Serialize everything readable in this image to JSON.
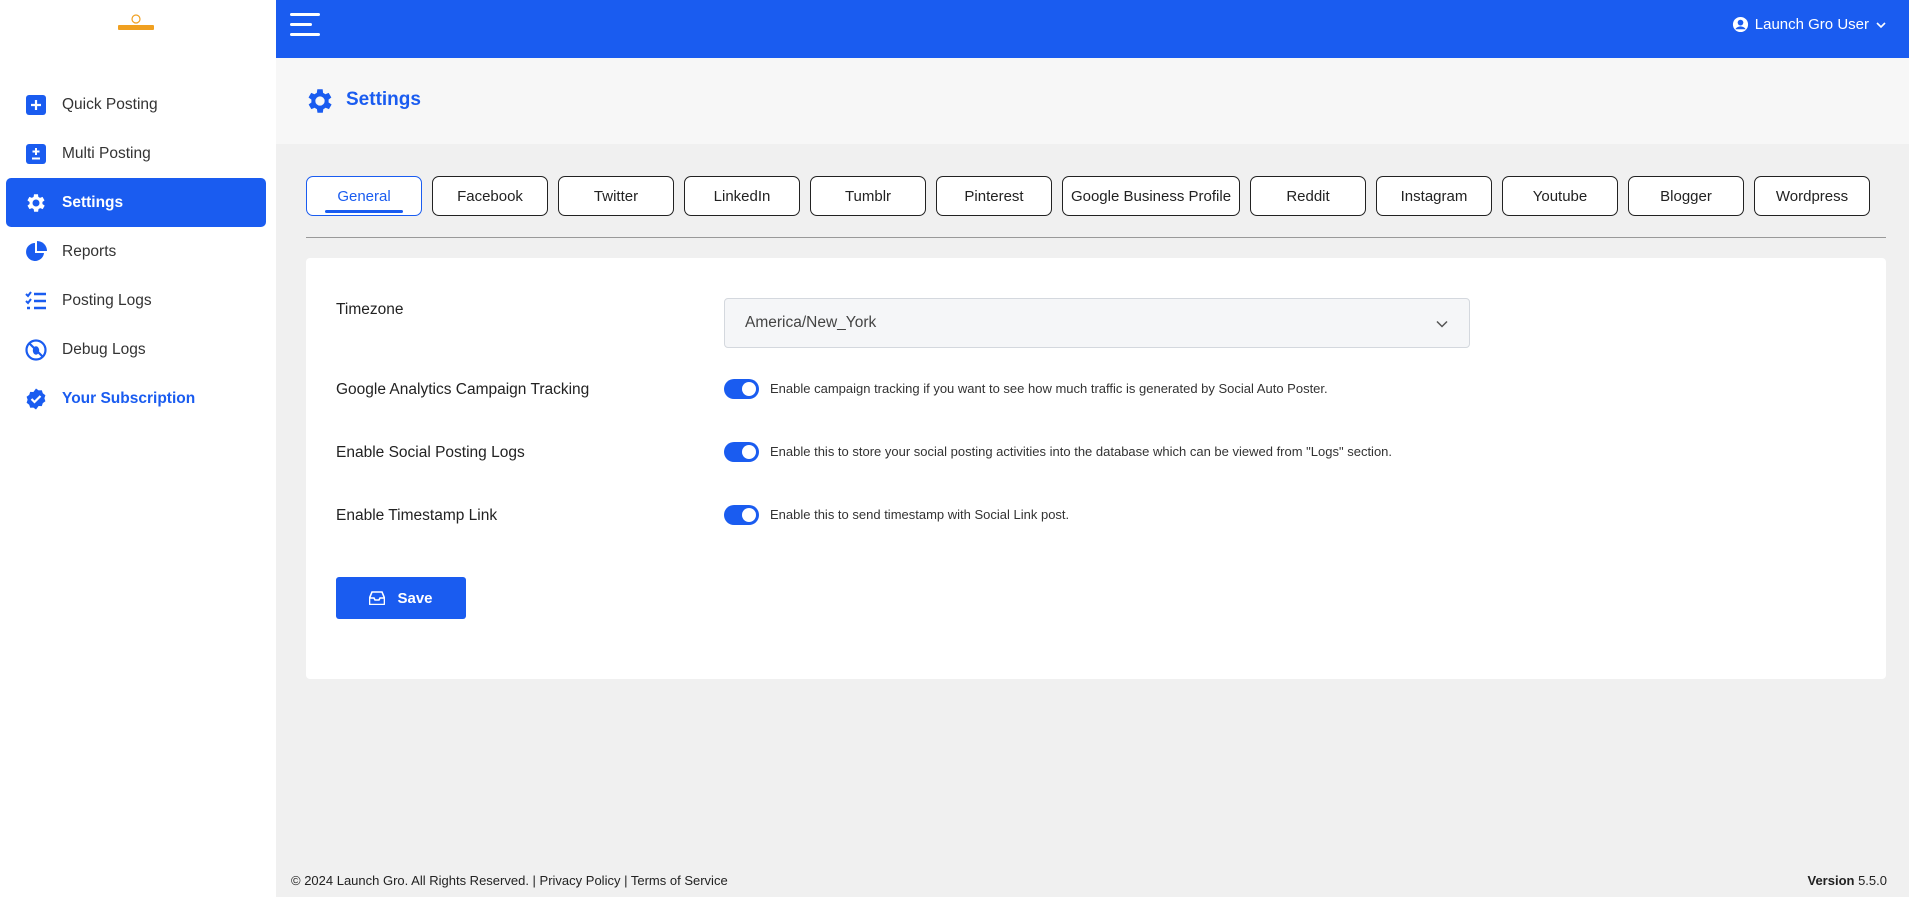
{
  "sidebar": {
    "items": [
      {
        "label": "Quick Posting",
        "icon": "plus-square-icon"
      },
      {
        "label": "Multi Posting",
        "icon": "plus-minus-square-icon"
      },
      {
        "label": "Settings",
        "icon": "gear-icon"
      },
      {
        "label": "Reports",
        "icon": "pie-chart-icon"
      },
      {
        "label": "Posting Logs",
        "icon": "list-check-icon"
      },
      {
        "label": "Debug Logs",
        "icon": "bug-off-icon"
      },
      {
        "label": "Your Subscription",
        "icon": "verified-badge-icon"
      }
    ],
    "active_index": 2
  },
  "topbar": {
    "user_name": "Launch Gro User"
  },
  "header": {
    "title": "Settings"
  },
  "tabs": [
    {
      "label": "General"
    },
    {
      "label": "Facebook"
    },
    {
      "label": "Twitter"
    },
    {
      "label": "LinkedIn"
    },
    {
      "label": "Tumblr"
    },
    {
      "label": "Pinterest"
    },
    {
      "label": "Google Business Profile"
    },
    {
      "label": "Reddit"
    },
    {
      "label": "Instagram"
    },
    {
      "label": "Youtube"
    },
    {
      "label": "Blogger"
    },
    {
      "label": "Wordpress"
    }
  ],
  "form": {
    "timezone_label": "Timezone",
    "timezone_value": "America/New_York",
    "ga_label": "Google Analytics Campaign Tracking",
    "ga_desc": "Enable campaign tracking if you want to see how much traffic is generated by Social Auto Poster.",
    "logs_label": "Enable Social Posting Logs",
    "logs_desc": "Enable this to store your social posting activities into the database which can be viewed from \"Logs\" section.",
    "timestamp_label": "Enable Timestamp Link",
    "timestamp_desc": "Enable this to send timestamp with Social Link post.",
    "save_label": "Save"
  },
  "footer": {
    "copyright": "© 2024 Launch Gro. All Rights Reserved. |",
    "privacy": "Privacy Policy",
    "sep": "|",
    "terms": "Terms of Service",
    "version_label": "Version",
    "version_value": "5.5.0"
  },
  "colors": {
    "primary": "#1a5cf0",
    "logo": "#f0a020"
  }
}
